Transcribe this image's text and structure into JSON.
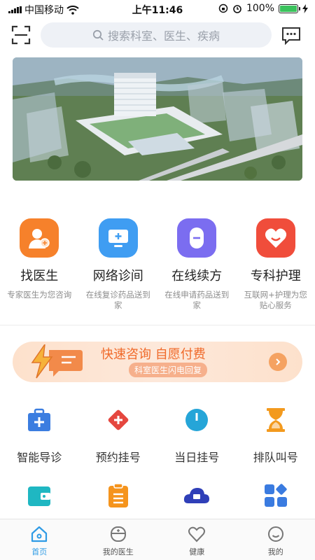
{
  "status_bar": {
    "carrier": "中国移动",
    "time": "上午11:46",
    "battery": "100%"
  },
  "header": {
    "search_placeholder": "搜索科室、医生、疾病"
  },
  "features": [
    {
      "title": "找医生",
      "desc": "专家医生为您咨询",
      "color": "#f6812b"
    },
    {
      "title": "网络诊间",
      "desc": "在线复诊药品送到家",
      "color": "#3f9df2"
    },
    {
      "title": "在线续方",
      "desc": "在线申请药品送到家",
      "color": "#7b6df0"
    },
    {
      "title": "专科护理",
      "desc": "互联网+护理为您贴心服务",
      "color": "#f04d3b"
    }
  ],
  "promo": {
    "title": "快速咨询 自愿付费",
    "subtitle": "科室医生闪电回复"
  },
  "services": [
    {
      "label": "智能导诊",
      "icon": "medical-kit-icon"
    },
    {
      "label": "预约挂号",
      "icon": "cross-diamond-icon"
    },
    {
      "label": "当日挂号",
      "icon": "clock-icon"
    },
    {
      "label": "排队叫号",
      "icon": "hourglass-icon"
    }
  ],
  "services_row2": [
    {
      "icon": "wallet-icon"
    },
    {
      "icon": "clipboard-icon"
    },
    {
      "icon": "cloud-icon"
    },
    {
      "icon": "apps-grid-icon"
    }
  ],
  "tabbar": [
    {
      "label": "首页",
      "icon": "home-icon",
      "active": true
    },
    {
      "label": "我的医生",
      "icon": "doctor-icon",
      "active": false
    },
    {
      "label": "健康",
      "icon": "heart-icon",
      "active": false
    },
    {
      "label": "我的",
      "icon": "smile-icon",
      "active": false
    }
  ],
  "colors": {
    "accent": "#2f9be5",
    "promo": "#f06a2a"
  }
}
